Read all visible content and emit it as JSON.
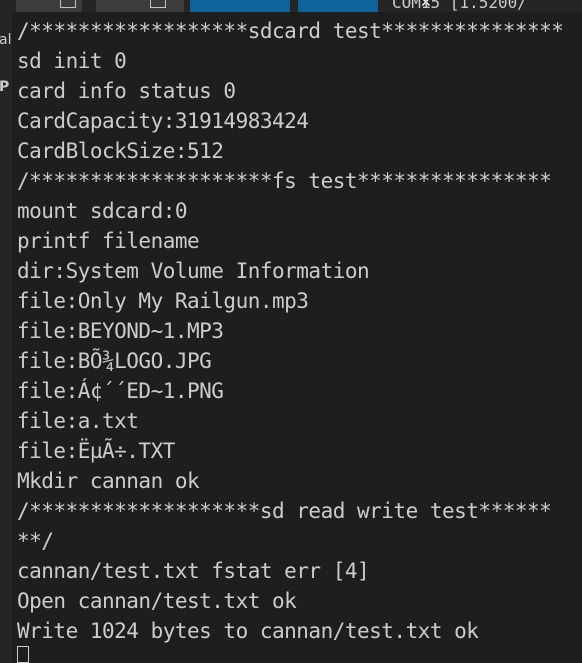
{
  "top_bar": {
    "right_fragment": "COM15  [1.5200/"
  },
  "sidebar": {
    "glyphs": [
      "al",
      "P"
    ]
  },
  "terminal": {
    "lines": [
      "/******************sdcard test***************",
      "sd init 0",
      "card info status 0",
      "CardCapacity:31914983424",
      "CardBlockSize:512",
      "/********************fs test****************",
      "mount sdcard:0",
      "printf filename",
      "dir:System Volume Information",
      "file:Only My Railgun.mp3",
      "file:BEYOND~1.MP3",
      "file:BÕ¾LOGO.JPG",
      "file:Á¢´´ED~1.PNG",
      "file:a.txt",
      "file:ËµÃ÷.TXT",
      "Mkdir cannan ok",
      "/*******************sd read write test******",
      "**/",
      "cannan/test.txt fstat err [4]",
      "Open cannan/test.txt ok",
      "Write 1024 bytes to cannan/test.txt ok"
    ]
  },
  "colors": {
    "background": "#1e1e1e",
    "text": "#cccccc",
    "tab_active": "#0e639c"
  }
}
